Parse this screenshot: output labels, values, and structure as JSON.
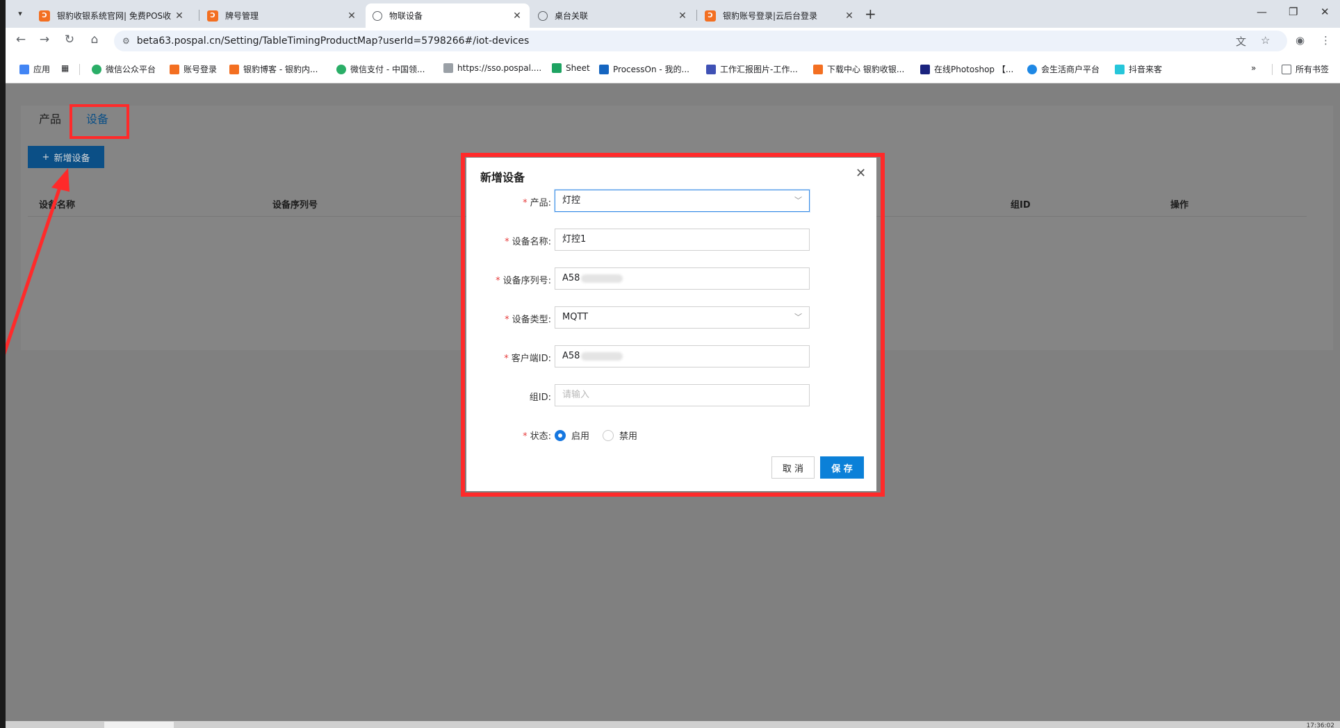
{
  "browser": {
    "tabs": [
      {
        "title": "银豹收银系统官网| 免费POS收",
        "icon": "orange-logo-icon"
      },
      {
        "title": "牌号管理",
        "icon": "orange-logo-icon"
      },
      {
        "title": "物联设备",
        "icon": "globe-icon"
      },
      {
        "title": "桌台关联",
        "icon": "globe-icon"
      },
      {
        "title": "银豹账号登录|云后台登录",
        "icon": "orange-logo-icon"
      }
    ],
    "url": "beta63.pospal.cn/Setting/TableTimingProductMap?userId=5798266#/iot-devices",
    "bookmarks": [
      {
        "label": "应用",
        "color": "#4285f4"
      },
      {
        "label": "微信公众平台",
        "color": "#2aae67"
      },
      {
        "label": "账号登录",
        "color": "#f36f21"
      },
      {
        "label": "银豹博客 - 银豹内...",
        "color": "#f36f21"
      },
      {
        "label": "微信支付 - 中国领...",
        "color": "#2aae67"
      },
      {
        "label": "https://sso.pospal....",
        "color": "#9aa0a6"
      },
      {
        "label": "Sheet",
        "color": "#1ea362"
      },
      {
        "label": "ProcessOn - 我的...",
        "color": "#1565c0"
      },
      {
        "label": "工作汇报图片-工作...",
        "color": "#3f51b5"
      },
      {
        "label": "下载中心 银豹收银...",
        "color": "#f36f21"
      },
      {
        "label": "在线Photoshop 【...",
        "color": "#1a237e"
      },
      {
        "label": "会生活商户平台",
        "color": "#1e88e5"
      },
      {
        "label": "抖音来客",
        "color": "#26c6da"
      }
    ],
    "all_bookmarks": "所有书签"
  },
  "page": {
    "tabs": [
      "产品",
      "设备"
    ],
    "add_button": "新增设备",
    "columns": [
      "设备名称",
      "设备序列号",
      "组ID",
      "操作"
    ]
  },
  "modal": {
    "title": "新增设备",
    "fields": [
      {
        "label": "产品:",
        "value": "灯控",
        "required": true
      },
      {
        "label": "设备名称:",
        "value": "灯控1",
        "required": true
      },
      {
        "label": "设备序列号:",
        "value": "A58",
        "required": true
      },
      {
        "label": "设备类型:",
        "value": "MQTT",
        "required": true
      },
      {
        "label": "客户端ID:",
        "value": "A58",
        "required": true
      },
      {
        "label": "组ID:",
        "placeholder": "请输入",
        "required": false
      }
    ],
    "status_label": "状态:",
    "status_options": [
      "启用",
      "禁用"
    ],
    "status_selected": "启用",
    "cancel": "取 消",
    "save": "保 存"
  },
  "status_clock": "17:36:02"
}
